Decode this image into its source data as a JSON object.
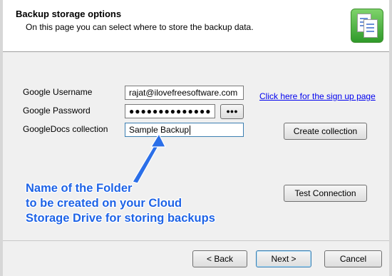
{
  "header": {
    "title": "Backup storage options",
    "subtitle": "On this page you can select where to store the backup data.",
    "icon": "backup-documents-icon"
  },
  "form": {
    "username_label": "Google Username",
    "username_value": "rajat@ilovefreesoftware.com",
    "password_label": "Google Password",
    "password_value": "●●●●●●●●●●●●●●",
    "show_password_label": "●●●",
    "collection_label": "GoogleDocs collection",
    "collection_value": "Sample Backup",
    "signup_link": "Click here for the sign up page",
    "create_collection_button": "Create collection",
    "test_connection_button": "Test Connection"
  },
  "annotation": {
    "line1": "Name of the Folder",
    "line2": "to be created on your Cloud",
    "line3": "Storage Drive for storing backups",
    "color": "#1e63e6"
  },
  "footer": {
    "back_button": "< Back",
    "next_button": "Next >",
    "cancel_button": "Cancel"
  }
}
